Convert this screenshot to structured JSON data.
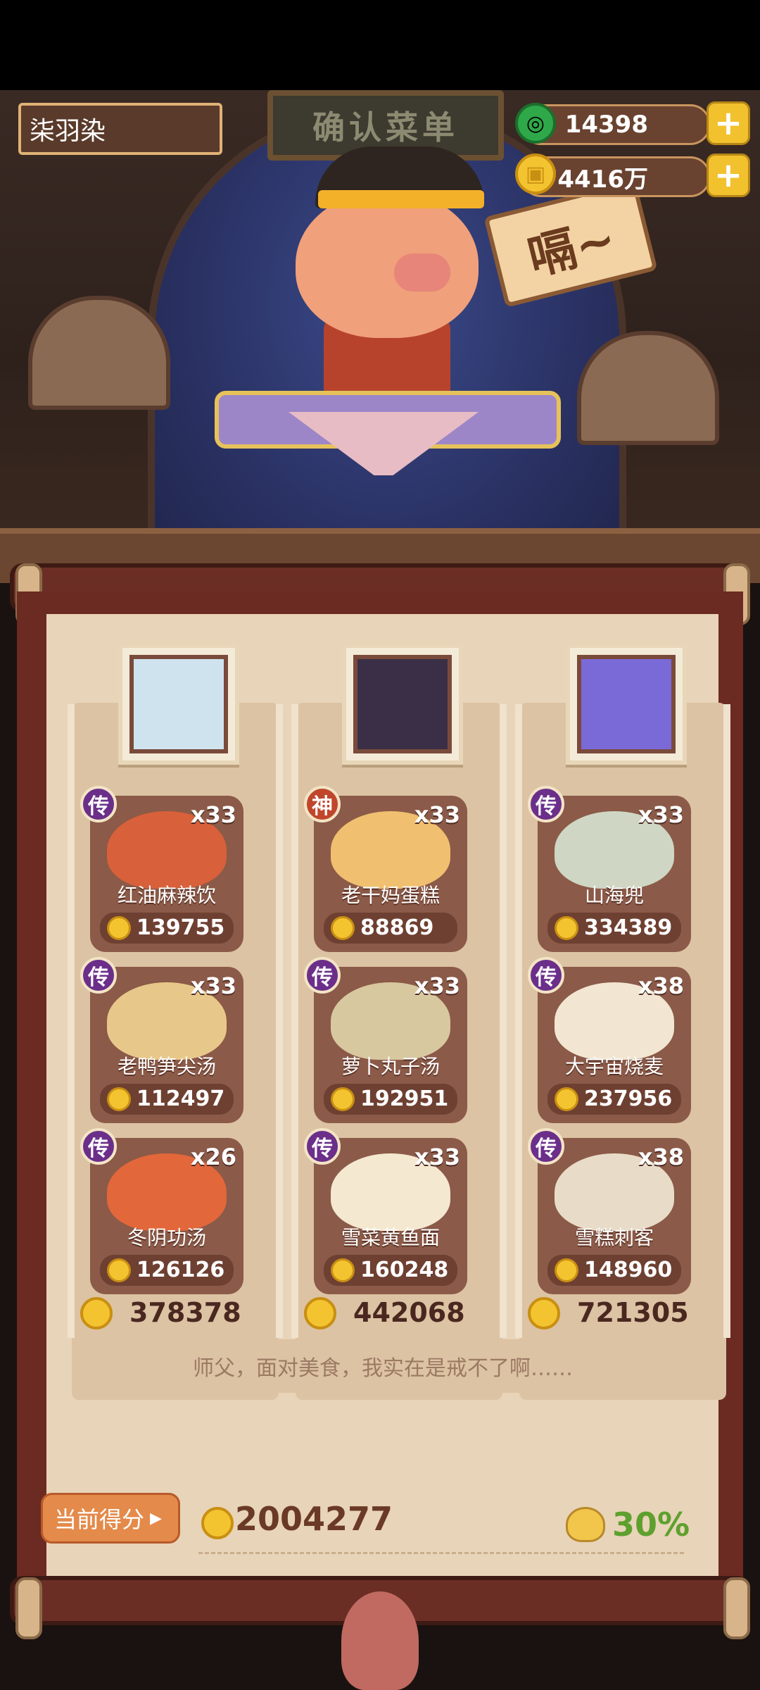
{
  "header": {
    "player_name": "柒羽染",
    "sign_text": "确认菜单",
    "jade_amount": "14398",
    "coin_amount": "74416万"
  },
  "scene": {
    "speech_text": "嗝~"
  },
  "columns": [
    {
      "total": "378378",
      "dishes": [
        {
          "badge": "传",
          "count": "x33",
          "name": "红油麻辣饮",
          "price": "139755",
          "color": "#d8603a"
        },
        {
          "badge": "传",
          "count": "x33",
          "name": "老鸭笋尖汤",
          "price": "112497",
          "color": "#e8c88a"
        },
        {
          "badge": "传",
          "count": "x26",
          "name": "冬阴功汤",
          "price": "126126",
          "color": "#e2673a"
        }
      ]
    },
    {
      "total": "442068",
      "dishes": [
        {
          "badge": "神",
          "count": "x33",
          "name": "老干妈蛋糕",
          "price": "88869",
          "color": "#f0c070"
        },
        {
          "badge": "传",
          "count": "x33",
          "name": "萝卜丸子汤",
          "price": "192951",
          "color": "#d8c8a0"
        },
        {
          "badge": "传",
          "count": "x33",
          "name": "雪菜黄鱼面",
          "price": "160248",
          "color": "#f4e8d0"
        }
      ]
    },
    {
      "total": "721305",
      "dishes": [
        {
          "badge": "传",
          "count": "x33",
          "name": "山海兜",
          "price": "334389",
          "color": "#cfd6c4"
        },
        {
          "badge": "传",
          "count": "x38",
          "name": "大宇宙烧麦",
          "price": "237956",
          "color": "#f2e6d2"
        },
        {
          "badge": "传",
          "count": "x38",
          "name": "雪糕刺客",
          "price": "148960",
          "color": "#e8dcc8"
        }
      ]
    }
  ],
  "quote": "师父，面对美食，我实在是戒不了啊……",
  "footer": {
    "score_label": "当前得分",
    "score_value": "2004277",
    "percent": "30%"
  }
}
